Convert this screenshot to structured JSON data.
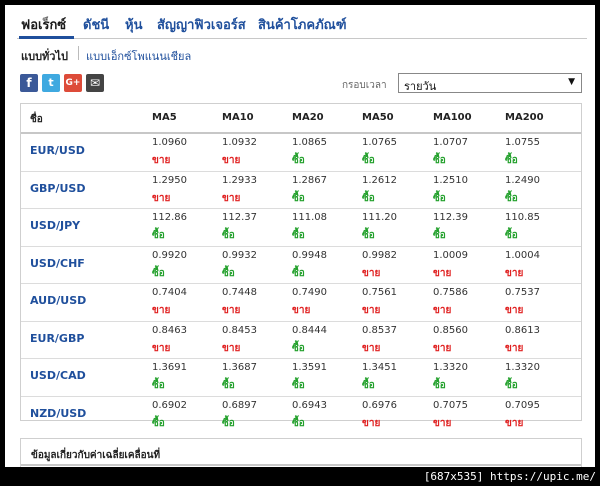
{
  "nav": {
    "tabs": [
      "ฟอเร็กซ์",
      "ดัชนี",
      "หุ้น",
      "สัญญาฟิวเจอร์ส",
      "สินค้าโภคภัณฑ์"
    ],
    "active": "ฟอเร็กซ์"
  },
  "subnav": {
    "tabs": [
      "แบบทั่วไป",
      "แบบเอ็กซ์โพแนนเชียล"
    ],
    "active": "แบบทั่วไป"
  },
  "share": {
    "icons": [
      "facebook-icon",
      "twitter-icon",
      "google-plus-icon",
      "email-icon"
    ],
    "labels": [
      "f",
      "t",
      "G+",
      "✉"
    ]
  },
  "timeframe": {
    "label": "กรอบเวลา",
    "value": "รายวัน",
    "arrow": "▼"
  },
  "table": {
    "headers": [
      "ชื่อ",
      "MA5",
      "MA10",
      "MA20",
      "MA50",
      "MA100",
      "MA200"
    ],
    "rows": [
      {
        "pair": "EUR/USD",
        "values": [
          "1.0960",
          "1.0932",
          "1.0865",
          "1.0765",
          "1.0707",
          "1.0755"
        ],
        "signals": [
          "ขาย",
          "ขาย",
          "ซื้อ",
          "ซื้อ",
          "ซื้อ",
          "ซื้อ"
        ]
      },
      {
        "pair": "GBP/USD",
        "values": [
          "1.2950",
          "1.2933",
          "1.2867",
          "1.2612",
          "1.2510",
          "1.2490"
        ],
        "signals": [
          "ขาย",
          "ขาย",
          "ซื้อ",
          "ซื้อ",
          "ซื้อ",
          "ซื้อ"
        ]
      },
      {
        "pair": "USD/JPY",
        "values": [
          "112.86",
          "112.37",
          "111.08",
          "111.20",
          "112.39",
          "110.85"
        ],
        "signals": [
          "ซื้อ",
          "ซื้อ",
          "ซื้อ",
          "ซื้อ",
          "ซื้อ",
          "ซื้อ"
        ]
      },
      {
        "pair": "USD/CHF",
        "values": [
          "0.9920",
          "0.9932",
          "0.9948",
          "0.9982",
          "1.0009",
          "1.0004"
        ],
        "signals": [
          "ซื้อ",
          "ซื้อ",
          "ซื้อ",
          "ขาย",
          "ขาย",
          "ขาย"
        ]
      },
      {
        "pair": "AUD/USD",
        "values": [
          "0.7404",
          "0.7448",
          "0.7490",
          "0.7561",
          "0.7586",
          "0.7537"
        ],
        "signals": [
          "ขาย",
          "ขาย",
          "ขาย",
          "ขาย",
          "ขาย",
          "ขาย"
        ]
      },
      {
        "pair": "EUR/GBP",
        "values": [
          "0.8463",
          "0.8453",
          "0.8444",
          "0.8537",
          "0.8560",
          "0.8613"
        ],
        "signals": [
          "ขาย",
          "ขาย",
          "ซื้อ",
          "ขาย",
          "ขาย",
          "ขาย"
        ]
      },
      {
        "pair": "USD/CAD",
        "values": [
          "1.3691",
          "1.3687",
          "1.3591",
          "1.3451",
          "1.3320",
          "1.3320"
        ],
        "signals": [
          "ซื้อ",
          "ซื้อ",
          "ซื้อ",
          "ซื้อ",
          "ซื้อ",
          "ซื้อ"
        ]
      },
      {
        "pair": "NZD/USD",
        "values": [
          "0.6902",
          "0.6897",
          "0.6943",
          "0.6976",
          "0.7075",
          "0.7095"
        ],
        "signals": [
          "ซื้อ",
          "ซื้อ",
          "ซื้อ",
          "ขาย",
          "ขาย",
          "ขาย"
        ]
      }
    ]
  },
  "info": {
    "title": "ข้อมูลเกี่ยวกับค่าเฉลี่ยเคลื่อนที่"
  },
  "watermark": "[687x535] https://upic.me/",
  "colors": {
    "link": "#1f4f9c",
    "buy": "#22a02b",
    "sell": "#e02020"
  },
  "signal_words": {
    "buy": "ซื้อ",
    "sell": "ขาย"
  }
}
